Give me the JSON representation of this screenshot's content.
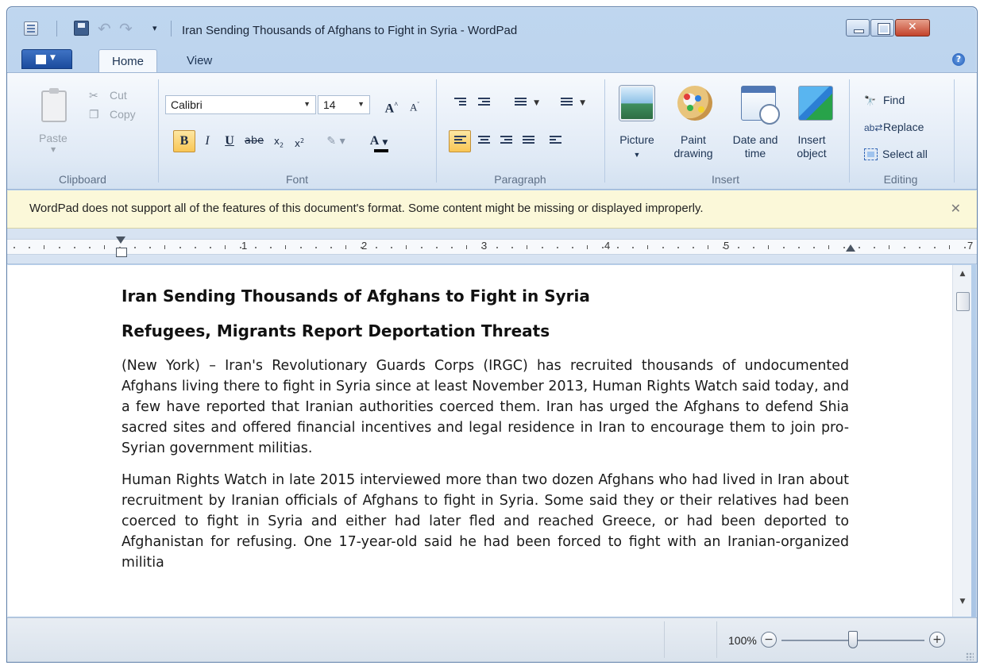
{
  "window": {
    "title": "Iran Sending Thousands of Afghans to Fight in Syria - WordPad"
  },
  "tabs": {
    "home": "Home",
    "view": "View"
  },
  "clipboard": {
    "paste": "Paste",
    "cut": "Cut",
    "copy": "Copy",
    "group_label": "Clipboard"
  },
  "font": {
    "family": "Calibri",
    "size": "14",
    "group_label": "Font"
  },
  "paragraph": {
    "group_label": "Paragraph"
  },
  "insert": {
    "picture": "Picture",
    "paint_line1": "Paint",
    "paint_line2": "drawing",
    "datetime_line1": "Date and",
    "datetime_line2": "time",
    "object_line1": "Insert",
    "object_line2": "object",
    "group_label": "Insert"
  },
  "editing": {
    "find": "Find",
    "replace": "Replace",
    "select_all": "Select all",
    "group_label": "Editing"
  },
  "infobar": {
    "message": "WordPad does not support all of the features of this document's format. Some content might be missing or displayed improperly."
  },
  "ruler": {
    "numbers": [
      "1",
      "2",
      "3",
      "4",
      "5",
      "7"
    ]
  },
  "document": {
    "heading1": "Iran Sending Thousands of Afghans to Fight in Syria",
    "heading2": "Refugees, Migrants Report Deportation Threats",
    "paragraph1": "(New York) – Iran's Revolutionary Guards Corps (IRGC) has recruited thousands of undocumented Afghans living there to fight in Syria since at least November 2013, Human Rights Watch said today, and a few have reported that Iranian authorities coerced them. Iran has urged the Afghans to defend Shia sacred sites and offered financial incentives and legal residence in Iran to encourage them to join pro-Syrian government militias.",
    "paragraph2": "Human Rights Watch in late 2015 interviewed more than two dozen Afghans who had lived in Iran about recruitment by Iranian officials of Afghans to fight in Syria. Some said they or their relatives had been coerced to fight in Syria and either had later fled and reached Greece, or had been deported to Afghanistan for refusing. One 17-year-old said he had been forced to fight with an Iranian-organized militia"
  },
  "status": {
    "zoom": "100%",
    "zoom_level_percent": 100
  }
}
